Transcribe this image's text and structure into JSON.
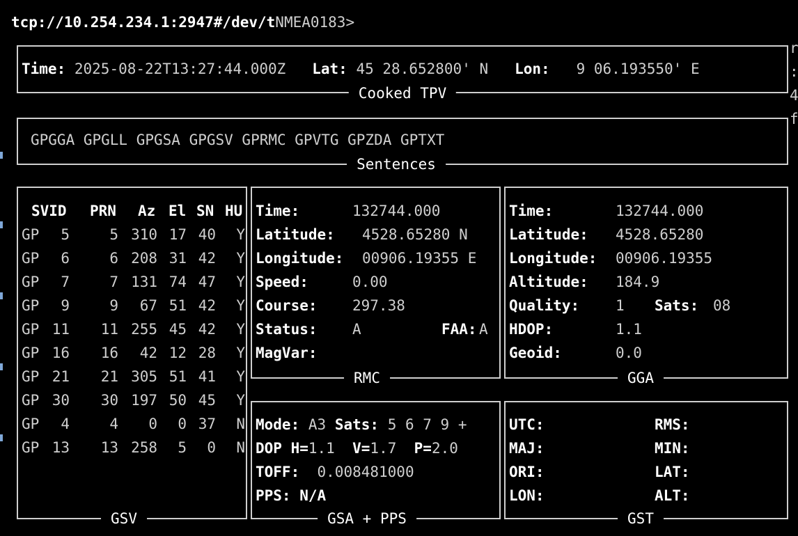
{
  "header": {
    "source": "tcp://10.254.234.1:2947#/dev/t",
    "prompt": "NMEA0183>"
  },
  "tpv": {
    "title": "Cooked TPV",
    "time_label": "Time:",
    "time": "2025-08-22T13:27:44.000Z",
    "lat_label": "Lat:",
    "lat": "45 28.652800' N",
    "lon_label": "Lon:",
    "lon": "9 06.193550' E"
  },
  "sentences": {
    "title": "Sentences",
    "list": "GPGGA GPGLL GPGSA GPGSV GPRMC GPVTG GPZDA GPTXT"
  },
  "gsv": {
    "title": "GSV",
    "columns": [
      "SVID",
      "PRN",
      "Az",
      "El",
      "SN",
      "HU"
    ],
    "rows": [
      [
        "GP",
        "5",
        "5",
        "310",
        "17",
        "40",
        "Y"
      ],
      [
        "GP",
        "6",
        "6",
        "208",
        "31",
        "42",
        "Y"
      ],
      [
        "GP",
        "7",
        "7",
        "131",
        "74",
        "47",
        "Y"
      ],
      [
        "GP",
        "9",
        "9",
        "67",
        "51",
        "42",
        "Y"
      ],
      [
        "GP",
        "11",
        "11",
        "255",
        "45",
        "42",
        "Y"
      ],
      [
        "GP",
        "16",
        "16",
        "42",
        "12",
        "28",
        "Y"
      ],
      [
        "GP",
        "21",
        "21",
        "305",
        "51",
        "41",
        "Y"
      ],
      [
        "GP",
        "30",
        "30",
        "197",
        "50",
        "45",
        "Y"
      ],
      [
        "GP",
        "4",
        "4",
        "0",
        "0",
        "37",
        "N"
      ],
      [
        "GP",
        "13",
        "13",
        "258",
        "5",
        "0",
        "N"
      ]
    ]
  },
  "rmc": {
    "title": "RMC",
    "time_label": "Time:",
    "time": "132744.000",
    "lat_label": "Latitude:",
    "lat": "4528.65280 N",
    "lon_label": "Longitude:",
    "lon": "00906.19355 E",
    "speed_label": "Speed:",
    "speed": "0.00",
    "course_label": "Course:",
    "course": "297.38",
    "status_label": "Status:",
    "status": "A",
    "faa_label": "FAA:",
    "faa": "A",
    "magvar_label": "MagVar:",
    "magvar": ""
  },
  "gga": {
    "title": "GGA",
    "time_label": "Time:",
    "time": "132744.000",
    "lat_label": "Latitude:",
    "lat": "4528.65280",
    "lon_label": "Longitude:",
    "lon": "00906.19355",
    "alt_label": "Altitude:",
    "alt": "184.9",
    "quality_label": "Quality:",
    "quality": "1",
    "sats_label": "Sats:",
    "sats": "08",
    "hdop_label": "HDOP:",
    "hdop": "1.1",
    "geoid_label": "Geoid:",
    "geoid": "0.0"
  },
  "gsa": {
    "title": "GSA + PPS",
    "mode_label": "Mode:",
    "mode": "A3",
    "sats_label": "Sats:",
    "sats": "5 6 7 9 +",
    "dop_label": "DOP",
    "h_label": "H=",
    "h": "1.1",
    "v_label": "V=",
    "v": "1.7",
    "p_label": "P=",
    "p": "2.0",
    "toff_label": "TOFF:",
    "toff": "0.008481000",
    "pps_label": "PPS:",
    "pps": "N/A"
  },
  "gst": {
    "title": "GST",
    "utc_label": "UTC:",
    "rms_label": "RMS:",
    "maj_label": "MAJ:",
    "min_label": "MIN:",
    "ori_label": "ORI:",
    "lat_label": "LAT:",
    "lon_label": "LON:",
    "alt_label": "ALT:"
  },
  "edge_glyphs": [
    "r",
    ":",
    "4",
    "f"
  ],
  "colors": {
    "background": "#000000",
    "foreground": "#cfcfcf",
    "bold": "#ffffff",
    "gutter": "#7fa8d8"
  }
}
